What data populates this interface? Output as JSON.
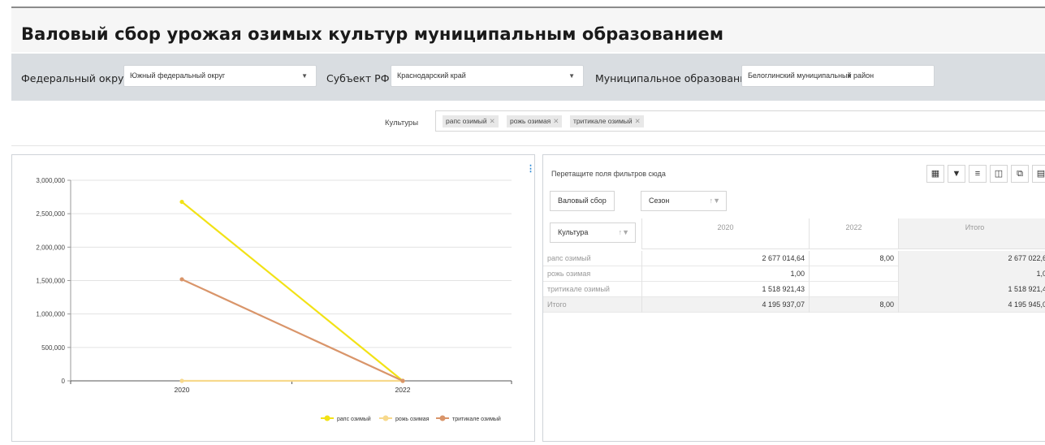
{
  "page": {
    "title": "Валовый сбор урожая озимых культур муниципальным образованием"
  },
  "filters": {
    "district_label": "Федеральный округ",
    "district_value": "Южный федеральный округ",
    "subject_label": "Субъект РФ",
    "subject_value": "Краснодарский край",
    "municipality_label": "Муниципальное образование",
    "municipality_value": "Белоглинский муниципальный район",
    "cultures_label": "Культуры",
    "cultures_tags": [
      "рапс озимый",
      "рожь озимая",
      "тритикале озимый"
    ]
  },
  "chart_data": {
    "type": "line",
    "x": [
      "2020",
      "2022"
    ],
    "ylim": [
      0,
      3000000
    ],
    "yticks": [
      "0",
      "500,000",
      "1,000,000",
      "1,500,000",
      "2,000,000",
      "2,500,000",
      "3,000,000"
    ],
    "series": [
      {
        "name": "рапс озимый",
        "values": [
          2677014.64,
          8.0
        ],
        "color": "#f2e216"
      },
      {
        "name": "рожь озимая",
        "values": [
          1.0,
          null
        ],
        "color": "#f7d98c"
      },
      {
        "name": "тритикале озимый",
        "values": [
          1518921.43,
          null
        ],
        "color": "#d9956a"
      }
    ],
    "legend": "bottom-right",
    "grid": true
  },
  "pivot": {
    "drop_hint": "Перетащите поля фильтров сюда",
    "measure_chip": "Валовый сбор",
    "column_chip": "Сезон",
    "row_chip": "Культура",
    "columns": [
      "2020",
      "2022",
      "Итого"
    ],
    "rows": [
      {
        "label": "рапс озимый",
        "v2020": "2 677 014,64",
        "v2022": "8,00",
        "total": "2 677 022,6"
      },
      {
        "label": "рожь озимая",
        "v2020": "1,00",
        "v2022": "",
        "total": "1,0"
      },
      {
        "label": "тритикале озимый",
        "v2020": "1 518 921,43",
        "v2022": "",
        "total": "1 518 921,4"
      },
      {
        "label": "Итого",
        "v2020": "4 195 937,07",
        "v2022": "8,00",
        "total": "4 195 945,0"
      }
    ]
  },
  "icons": {
    "chart_menu": "more-vertical-icon",
    "toolbar": [
      "table-settings-icon",
      "filter-icon",
      "clear-filter-icon",
      "export-icon",
      "copy-icon",
      "fullscreen-icon"
    ]
  }
}
